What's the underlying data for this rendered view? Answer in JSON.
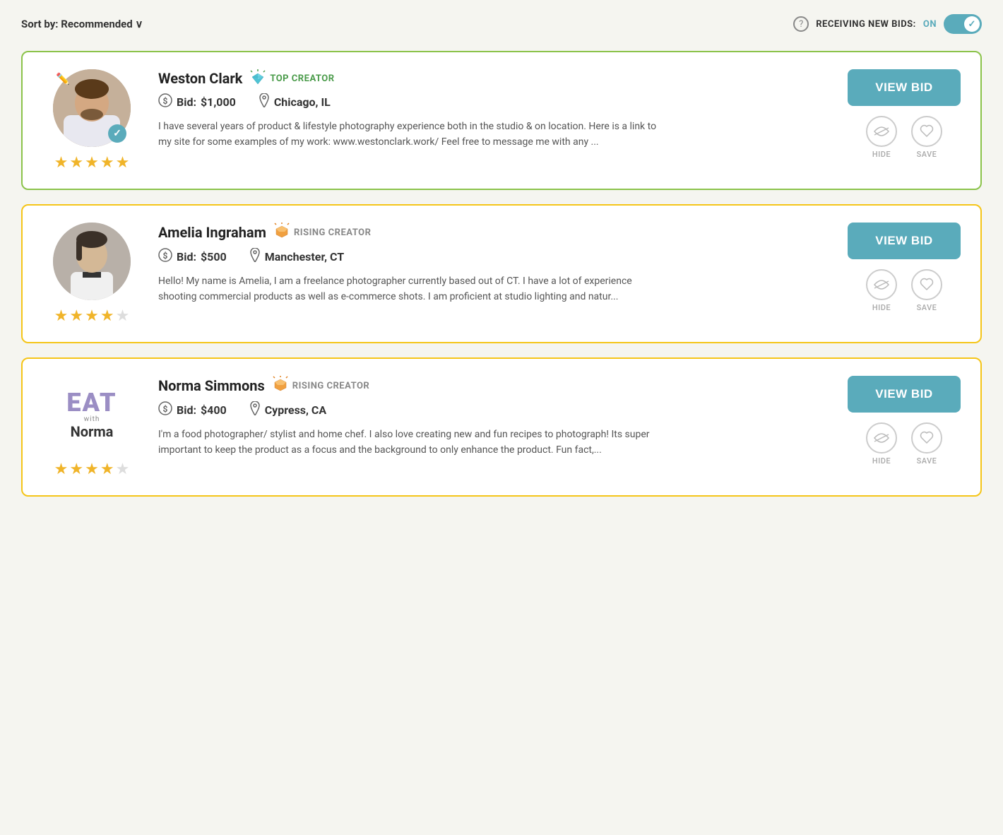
{
  "header": {
    "sort_label": "Sort by:",
    "sort_value": "Recommended",
    "sort_arrow": "∨",
    "receiving_label": "RECEIVING NEW BIDS:",
    "on_label": "ON",
    "toggle_on": true
  },
  "creators": [
    {
      "id": "weston",
      "name": "Weston Clark",
      "badge_type": "top",
      "badge_label": "TOP CREATOR",
      "bid_label": "Bid:",
      "bid_amount": "$1,000",
      "location": "Chicago, IL",
      "stars_filled": 5,
      "stars_empty": 0,
      "description": "I have several years of product & lifestyle photography experience both in the studio & on location. Here is a link to my site for some examples of my work: www.westonclark.work/ Feel free to message me with any ...",
      "view_bid_label": "VIEW BID",
      "hide_label": "HIDE",
      "save_label": "SAVE",
      "card_border": "green",
      "verified": true
    },
    {
      "id": "amelia",
      "name": "Amelia Ingraham",
      "badge_type": "rising",
      "badge_label": "RISING CREATOR",
      "bid_label": "Bid:",
      "bid_amount": "$500",
      "location": "Manchester, CT",
      "stars_filled": 4,
      "stars_empty": 1,
      "description": "Hello! My name is Amelia, I am a freelance photographer currently based out of CT. I have a lot of experience shooting commercial products as well as e-commerce shots. I am proficient at studio lighting and natur...",
      "view_bid_label": "VIEW BID",
      "hide_label": "HIDE",
      "save_label": "SAVE",
      "card_border": "yellow",
      "verified": false
    },
    {
      "id": "norma",
      "name": "Norma Simmons",
      "badge_type": "rising",
      "badge_label": "RISING CREATOR",
      "bid_label": "Bid:",
      "bid_amount": "$400",
      "location": "Cypress, CA",
      "stars_filled": 4,
      "stars_empty": 1,
      "description": "I'm a food photographer/ stylist and home chef. I also love creating new and fun recipes to photograph! Its super important to keep the product as a focus and the background to only enhance the product. Fun fact,...",
      "view_bid_label": "VIEW BID",
      "hide_label": "HIDE",
      "save_label": "SAVE",
      "card_border": "yellow",
      "verified": false
    }
  ]
}
